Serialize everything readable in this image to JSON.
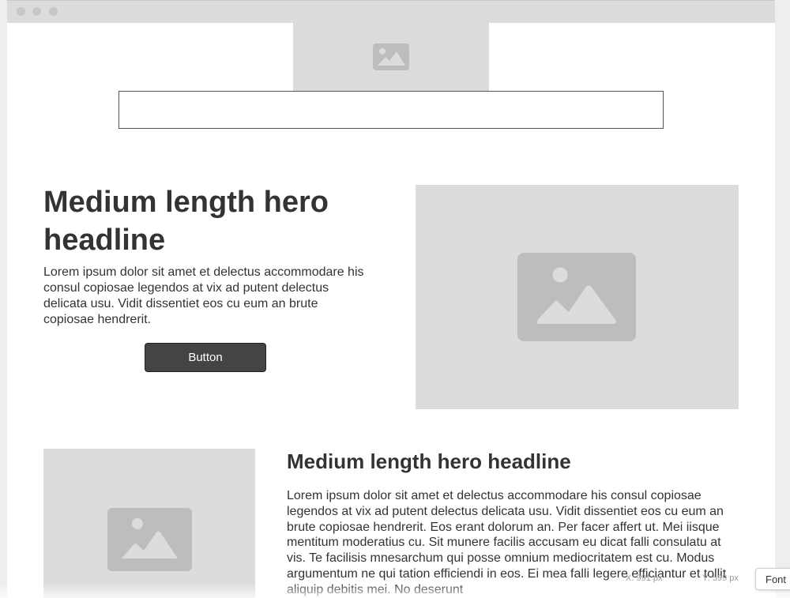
{
  "window": {
    "controls": [
      "close",
      "minimize",
      "zoom"
    ]
  },
  "logo": {
    "icon": "image-placeholder-icon"
  },
  "search": {
    "value": "",
    "placeholder": ""
  },
  "hero": {
    "headline": "Medium length hero headline",
    "body": "Lorem ipsum dolor sit amet et delectus accommodare his consul copiosae legendos at vix ad putent delectus delicata usu. Vidit dissentiet eos cu eum an brute copiosae hendrerit.",
    "button_label": "Button",
    "image_icon": "image-placeholder-icon"
  },
  "feature": {
    "headline": "Medium length hero headline",
    "body": "Lorem ipsum dolor sit amet et delectus accommodare his consul copiosae legendos at vix ad putent delectus delicata usu. Vidit dissentiet eos cu eum an brute copiosae hendrerit. Eos erant dolorum an. Per facer affert ut. Mei iisque mentitum moderatius cu. Sit munere facilis accusam eu dicat falli consulatu at vis. Te facilisis mnesarchum qui posse omnium mediocritatem est cu. Modus argumentum ne qui tation efficiendi in eos. Ei mea falli legere efficiantur et tollit aliquip debitis mei. No deserunt",
    "image_icon": "image-placeholder-icon"
  },
  "overlay": {
    "x_readout": "X: 991 px",
    "y_readout": "Y: 599 px",
    "font_tab": "Font"
  },
  "colors": {
    "placeholder_bg": "#dcdcdc",
    "placeholder_icon": "#bdbdbd",
    "button_bg": "#444444",
    "text": "#333333"
  }
}
